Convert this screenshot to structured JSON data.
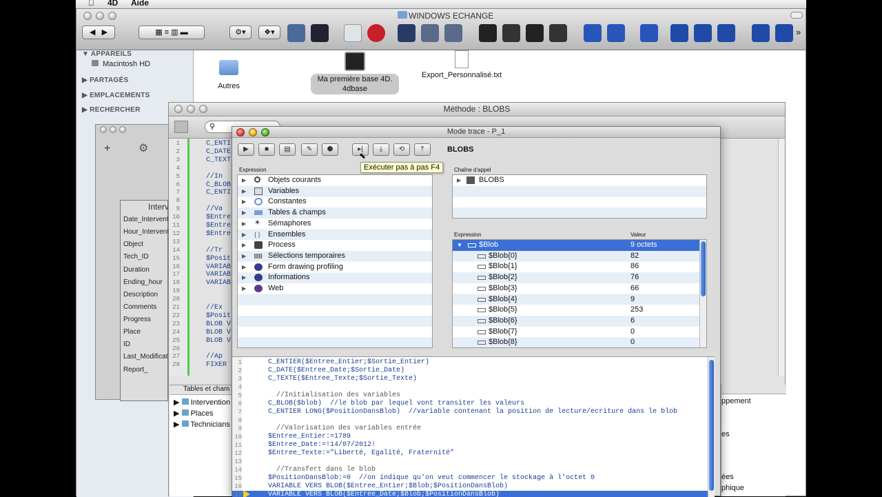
{
  "menubar": {
    "app": "4D",
    "help": "Aide"
  },
  "finder": {
    "title": "WINDOWS ECHANGE",
    "sidebar": {
      "sections": [
        "APPAREILS",
        "PARTAGÉS",
        "EMPLACEMENTS",
        "RECHERCHER"
      ],
      "device": "Macintosh HD"
    },
    "files": [
      {
        "label": "Autres"
      },
      {
        "label_line1": "Ma première base 4D.",
        "label_line2": "4dbase"
      },
      {
        "label": "Export_Personnalisé.txt"
      }
    ]
  },
  "methode": {
    "title": "Méthode : BLOBS",
    "left_code": [
      "C_ENTI",
      "C_DATE",
      "C_TEXT",
      "",
      "//In",
      "C_BLOB",
      "C_ENTI",
      "",
      "//Va",
      "$Entre",
      "$Entre",
      "$Entre",
      "",
      "//Tr",
      "$Posit",
      "VARIAB",
      "VARIAB",
      "VARIAB",
      "",
      "",
      "//Ex",
      "$Posit",
      "BLOB V",
      "BLOB V",
      "BLOB V",
      "",
      "//Ap",
      "FIXER"
    ],
    "left_lines": [
      "1",
      "2",
      "3",
      "4",
      "5",
      "6",
      "7",
      "8",
      "9",
      "10",
      "11",
      "12",
      "13",
      "14",
      "15",
      "16",
      "17",
      "18",
      "19",
      "20",
      "21",
      "22",
      "23",
      "24",
      "25",
      "26",
      "27",
      "28"
    ]
  },
  "explorer": {
    "table_title": "Interv",
    "fields": [
      "Date_Intervent",
      "Hour_Intervent",
      "Object",
      "Tech_ID",
      "Duration",
      "Ending_hour",
      "Description",
      "Comments",
      "Progress",
      "Place",
      "ID",
      "Last_Modificat",
      "Report_"
    ],
    "tables_header": "Tables et cham",
    "tables": [
      "Intervention",
      "Places",
      "Technicians"
    ]
  },
  "right_partial": [
    "ppement",
    "es",
    "ées",
    "phique"
  ],
  "trace": {
    "title": "Mode trace - P_1",
    "method_name": "BLOBS",
    "tooltip": "Exécuter pas à pas F4",
    "expression_header": "Expression",
    "expressions": [
      "Objets courants",
      "Variables",
      "Constantes",
      "Tables & champs",
      "Sémaphores",
      "Ensembles",
      "Process",
      "Sélections temporaires",
      "Form drawing profiling",
      "Informations",
      "Web"
    ],
    "callchain_header": "Chaîne d'appel",
    "callchain": [
      "BLOBS"
    ],
    "watch_header_expr": "Expression",
    "watch_header_val": "Valeur",
    "watch": [
      {
        "name": "$Blob",
        "value": "9 octets"
      },
      {
        "name": "$Blob{0}",
        "value": "82"
      },
      {
        "name": "$Blob{1}",
        "value": "86"
      },
      {
        "name": "$Blob{2}",
        "value": "76"
      },
      {
        "name": "$Blob{3}",
        "value": "66"
      },
      {
        "name": "$Blob{4}",
        "value": "9"
      },
      {
        "name": "$Blob{5}",
        "value": "253"
      },
      {
        "name": "$Blob{6}",
        "value": "6"
      },
      {
        "name": "$Blob{7}",
        "value": "0"
      },
      {
        "name": "$Blob{8}",
        "value": "0"
      }
    ],
    "code_lines": [
      {
        "n": "1",
        "t": "C_ENTIER($Entree_Entier;$Sortie_Entier)"
      },
      {
        "n": "2",
        "t": "C_DATE($Entree_Date;$Sortie_Date)"
      },
      {
        "n": "3",
        "t": "C_TEXTE($Entree_Texte;$Sortie_Texte)"
      },
      {
        "n": "4",
        "t": ""
      },
      {
        "n": "5",
        "t": "  //Initialisation des variables"
      },
      {
        "n": "6",
        "t": "C_BLOB($blob)  //le blob par lequel vont transiter les valeurs"
      },
      {
        "n": "7",
        "t": "C_ENTIER LONG($PositionDansBlob)  //variable contenant la position de lecture/ecriture dans le blob"
      },
      {
        "n": "8",
        "t": ""
      },
      {
        "n": "9",
        "t": "  //Valorisation des variables entrée"
      },
      {
        "n": "10",
        "t": "$Entree_Entier:=1789"
      },
      {
        "n": "11",
        "t": "$Entree_Date:=!14/07/2012!"
      },
      {
        "n": "12",
        "t": "$Entree_Texte:=\"Liberté, Egalité, Fraternité\""
      },
      {
        "n": "13",
        "t": ""
      },
      {
        "n": "14",
        "t": "  //Transfert dans le blob"
      },
      {
        "n": "15",
        "t": "$PositionDansBlob:=0  //on indique qu'on veut commencer le stockage à l'octet 0"
      },
      {
        "n": "16",
        "t": "VARIABLE VERS BLOB($Entree_Entier;$Blob;$PositionDansBlob)"
      },
      {
        "n": "17",
        "t": "VARIABLE VERS BLOB($Entree_Date;$Blob;$PositionDansBlob)"
      }
    ]
  }
}
